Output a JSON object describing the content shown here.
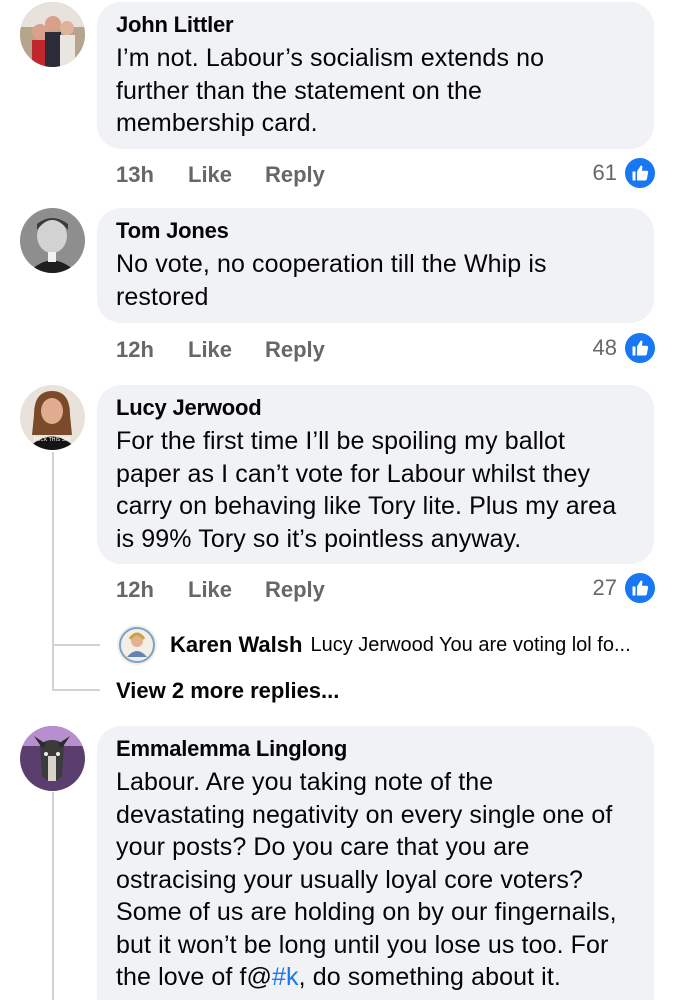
{
  "comments": [
    {
      "author": "John Littler",
      "text": "I’m not. Labour’s socialism extends no\nfurther than the statement on the\nmembership card.",
      "time": "13h",
      "like_label": "Like",
      "reply_label": "Reply",
      "reaction_count": "61"
    },
    {
      "author": "Tom Jones",
      "text": "No vote, no cooperation till the Whip is\nrestored",
      "time": "12h",
      "like_label": "Like",
      "reply_label": "Reply",
      "reaction_count": "48"
    },
    {
      "author": "Lucy Jerwood",
      "text": "For the first time I’ll be spoiling my ballot\npaper as I can’t vote for Labour whilst they\ncarry on behaving like Tory lite. Plus my area\nis 99% Tory so it’s pointless anyway.",
      "time": "12h",
      "like_label": "Like",
      "reply_label": "Reply",
      "reaction_count": "27",
      "avatar_text": "FUCK THIS SHI",
      "reply_preview": {
        "author": "Karen Walsh",
        "text": "Lucy Jerwood You are voting lol fo..."
      },
      "view_more": "View 2 more replies..."
    },
    {
      "author": "Emmalemma Linglong",
      "text_before": "Labour. Are you taking note of the\ndevastating negativity on every single one of\nyour posts? Do you care that you are\nostracising your usually loyal core voters?\nSome of us are holding on by our fingernails,\nbut it won’t be long until you lose us too. For\nthe love of f@",
      "hashtag": "#k",
      "text_after": ", do something about it."
    }
  ],
  "colors": {
    "bubble_bg": "#f0f2f5",
    "meta_text": "#65676b",
    "accent": "#1877f2"
  },
  "icons": [
    "like-icon"
  ]
}
